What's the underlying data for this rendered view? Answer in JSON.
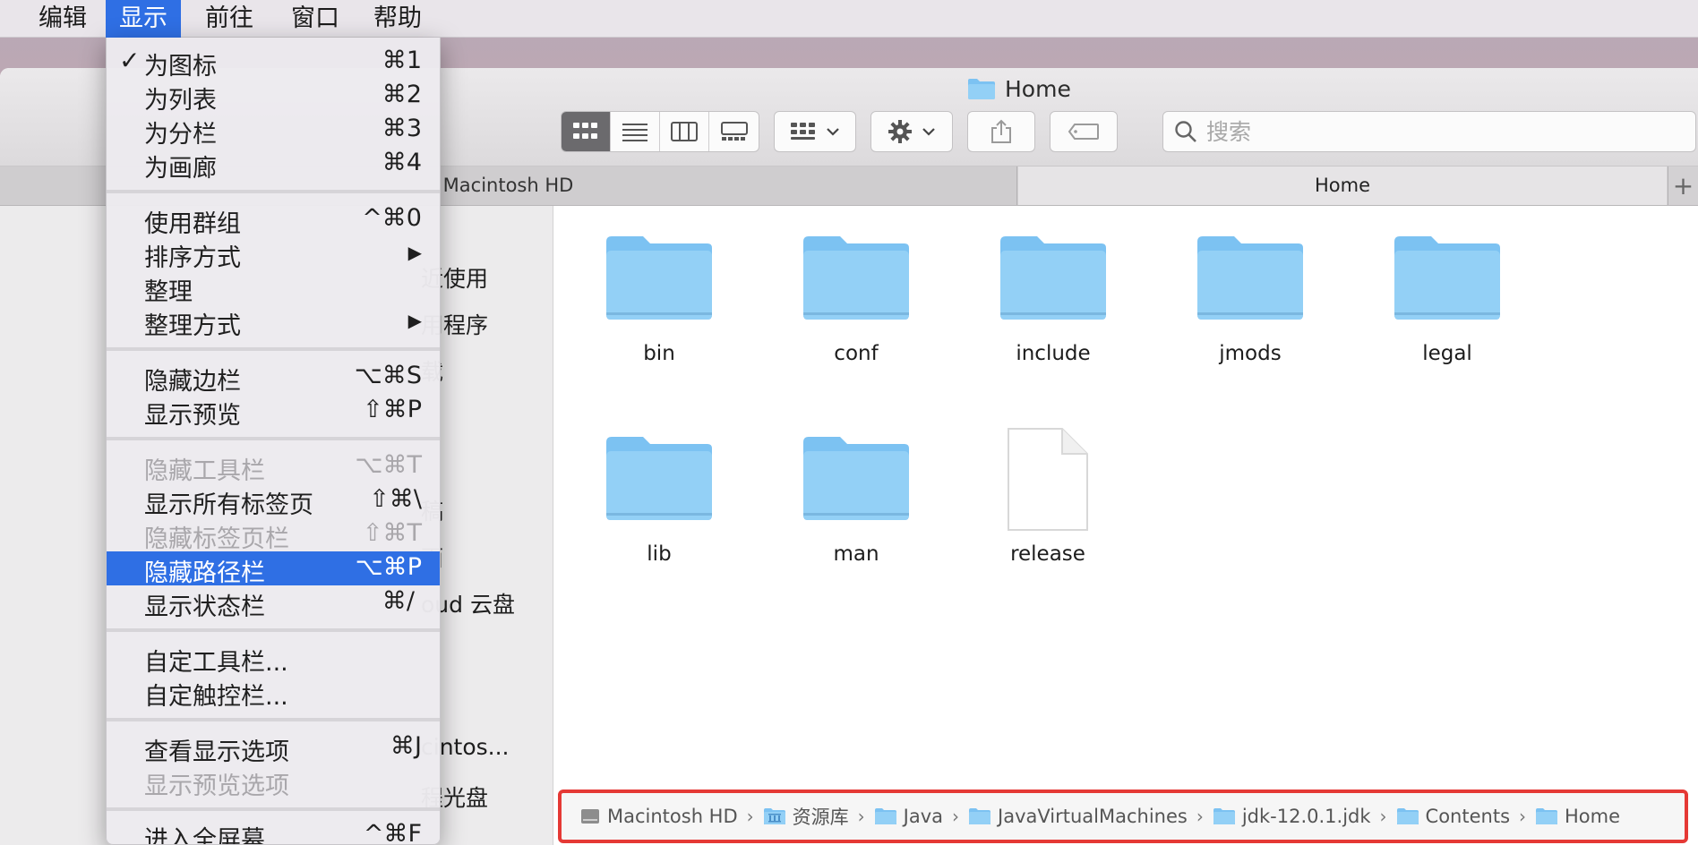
{
  "menubar": {
    "items": [
      {
        "label": "编辑"
      },
      {
        "label": "显示"
      },
      {
        "label": "前往"
      },
      {
        "label": "窗口"
      },
      {
        "label": "帮助"
      }
    ],
    "active_index": 1
  },
  "window": {
    "title": "Home",
    "toolbar": {
      "search_placeholder": "搜索",
      "view_modes": [
        "icon-view",
        "list-view",
        "column-view",
        "gallery-view"
      ],
      "active_view": 0
    },
    "tabs": [
      {
        "label": "Macintosh HD"
      },
      {
        "label": "Home"
      }
    ],
    "add_tab": "+"
  },
  "sidebar": {
    "items": [
      {
        "label": "近使用"
      },
      {
        "label": "用程序"
      },
      {
        "label": "载"
      },
      {
        "label": "稿"
      },
      {
        "label": "面"
      },
      {
        "label": "oud 云盘"
      },
      {
        "label": "cintos..."
      },
      {
        "label": "程光盘"
      }
    ]
  },
  "files": [
    {
      "name": "bin",
      "type": "folder"
    },
    {
      "name": "conf",
      "type": "folder"
    },
    {
      "name": "include",
      "type": "folder"
    },
    {
      "name": "jmods",
      "type": "folder"
    },
    {
      "name": "legal",
      "type": "folder"
    },
    {
      "name": "lib",
      "type": "folder"
    },
    {
      "name": "man",
      "type": "folder"
    },
    {
      "name": "release",
      "type": "document"
    }
  ],
  "pathbar": {
    "crumbs": [
      {
        "label": "Macintosh HD",
        "icon": "disk-icon"
      },
      {
        "label": "资源库",
        "icon": "library-folder-icon"
      },
      {
        "label": "Java",
        "icon": "folder-icon"
      },
      {
        "label": "JavaVirtualMachines",
        "icon": "folder-icon"
      },
      {
        "label": "jdk-12.0.1.jdk",
        "icon": "folder-icon"
      },
      {
        "label": "Contents",
        "icon": "folder-icon"
      },
      {
        "label": "Home",
        "icon": "folder-icon"
      }
    ],
    "separator": "›"
  },
  "view_menu": {
    "items": [
      {
        "label": "为图标",
        "shortcut": "⌘1",
        "checked": true
      },
      {
        "label": "为列表",
        "shortcut": "⌘2"
      },
      {
        "label": "为分栏",
        "shortcut": "⌘3"
      },
      {
        "label": "为画廊",
        "shortcut": "⌘4"
      },
      {
        "label": "使用群组",
        "shortcut": "^⌘0"
      },
      {
        "label": "排序方式",
        "shortcut": "▶"
      },
      {
        "label": "整理",
        "shortcut": ""
      },
      {
        "label": "整理方式",
        "shortcut": "▶"
      },
      {
        "label": "隐藏边栏",
        "shortcut": "⌥⌘S"
      },
      {
        "label": "显示预览",
        "shortcut": "⇧⌘P"
      },
      {
        "label": "隐藏工具栏",
        "shortcut": "⌥⌘T",
        "disabled": true
      },
      {
        "label": "显示所有标签页",
        "shortcut": "⇧⌘\\"
      },
      {
        "label": "隐藏标签页栏",
        "shortcut": "⇧⌘T",
        "disabled": true
      },
      {
        "label": "隐藏路径栏",
        "shortcut": "⌥⌘P",
        "highlighted": true
      },
      {
        "label": "显示状态栏",
        "shortcut": "⌘/"
      },
      {
        "label": "自定工具栏...",
        "shortcut": ""
      },
      {
        "label": "自定触控栏...",
        "shortcut": ""
      },
      {
        "label": "查看显示选项",
        "shortcut": "⌘J"
      },
      {
        "label": "显示预览选项",
        "shortcut": "",
        "disabled": true
      },
      {
        "label": "进入全屏幕",
        "shortcut": "^⌘F"
      }
    ],
    "checkmark": "✓"
  },
  "colors": {
    "accent": "#2f6fe4",
    "folder": "#7cc2f2",
    "highlight_border": "#e53935"
  }
}
